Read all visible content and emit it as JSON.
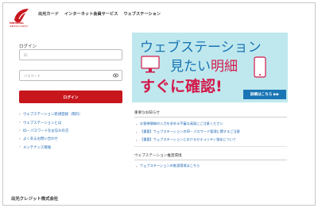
{
  "header": {
    "logo_name": "idemitsu",
    "logo_sub": "IDEMITSU CREDIT",
    "nav": [
      "出光カード",
      "インターネット会員サービス",
      "ウェブステーション"
    ]
  },
  "login": {
    "title": "ログイン",
    "id_placeholder": "ID",
    "password_placeholder": "パスワード",
    "button_label": "ログイン",
    "links": [
      "ウェブステーション新規登録（無料）",
      "ウェブステーションとは",
      "ID・パスワードをお忘れの方",
      "よくあるお問い合わせ",
      "メンテナンス情報"
    ]
  },
  "banner": {
    "line1": "ウェブステーション",
    "line2_prefix": "見たい",
    "line2_accent": "明細",
    "line3": "すぐに確認!",
    "cta": "詳細はこちら ▶▶"
  },
  "news": {
    "title": "重要なお知らせ",
    "items": [
      "お客様情報の入力を求める不審な画面にご注意ください",
      "【重要】ウェブステーションのID・パスワード管理に関するご注意",
      "【重要】ウェブステーションにおけるセキュリティ強化について"
    ]
  },
  "recommended": {
    "title": "ウェブステーション推奨環境",
    "items": [
      "ウェブステーションの推奨環境はこちら"
    ]
  },
  "footer": {
    "brand": "出光クレジット株式会社"
  },
  "colors": {
    "brand_red": "#c8161d",
    "link_blue": "#1f66b3",
    "banner_bg": "#bfe8ee",
    "banner_blue": "#1a75b4",
    "banner_pink": "#d31a4b"
  },
  "icons": {
    "logo": "idemitsu-logo-icon",
    "password_toggle": "eye-icon",
    "link_bullet": "chevron-right-icon"
  }
}
